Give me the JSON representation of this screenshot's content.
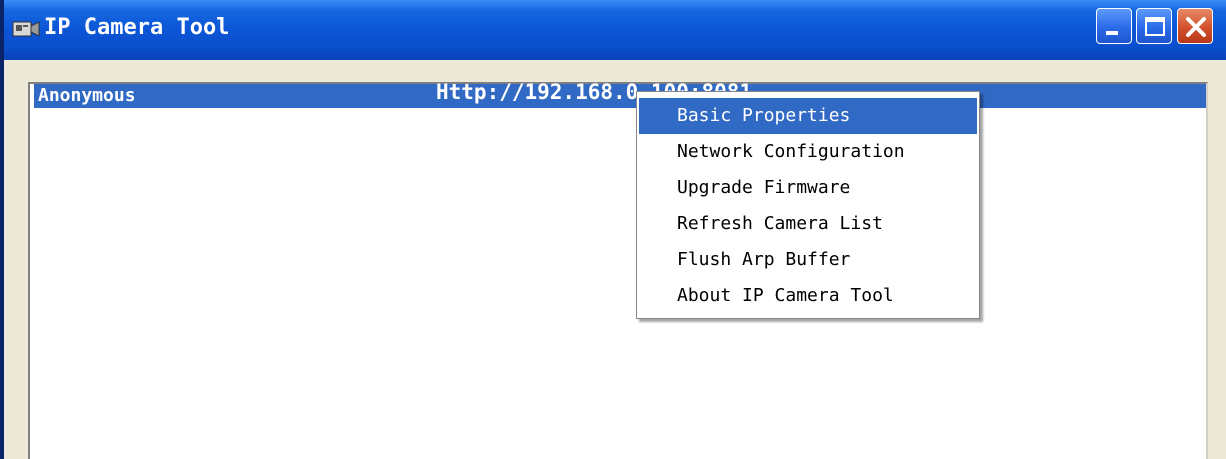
{
  "window": {
    "title": "IP Camera Tool",
    "icons": {
      "app": "camera-app-icon",
      "minimize": "minimize-icon",
      "maximize": "maximize-icon",
      "close": "close-icon"
    }
  },
  "camera_list": {
    "rows": [
      {
        "name": "Anonymous",
        "url": "Http://192.168.0.100:8081",
        "selected": true
      }
    ]
  },
  "context_menu": {
    "items": [
      {
        "label": "Basic Properties",
        "selected": true
      },
      {
        "label": "Network Configuration",
        "selected": false
      },
      {
        "label": "Upgrade Firmware",
        "selected": false
      },
      {
        "label": "Refresh Camera List",
        "selected": false
      },
      {
        "label": "Flush Arp Buffer",
        "selected": false
      },
      {
        "label": "About IP Camera Tool",
        "selected": false
      }
    ]
  },
  "colors": {
    "titlebar": "#0A4FCC",
    "selection": "#316AC5",
    "close_button": "#D3502B"
  }
}
